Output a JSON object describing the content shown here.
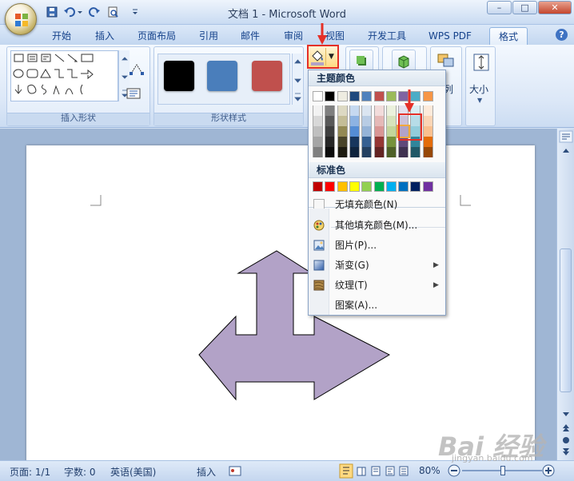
{
  "window": {
    "title": "文档 1 - Microsoft Word",
    "controls": {
      "minimize": "–",
      "maximize": "□",
      "close": "✕"
    }
  },
  "quick_access": [
    "save-icon",
    "undo-icon",
    "dropdown-icon",
    "redo-icon",
    "print-preview-icon",
    "customize-icon"
  ],
  "tabs": [
    {
      "label": "开始"
    },
    {
      "label": "插入"
    },
    {
      "label": "页面布局"
    },
    {
      "label": "引用"
    },
    {
      "label": "邮件"
    },
    {
      "label": "审阅"
    },
    {
      "label": "视图"
    },
    {
      "label": "开发工具"
    },
    {
      "label": "WPS PDF"
    },
    {
      "label": "格式",
      "active": true
    }
  ],
  "ribbon": {
    "groups": {
      "insert_shapes": "插入形状",
      "shape_styles": "形状样式",
      "size": "大小",
      "arrange_partial": "列"
    },
    "style_swatches": [
      "#000000",
      "#4a7ebb",
      "#c0504d"
    ]
  },
  "fill_menu": {
    "theme_colors_header": "主题颜色",
    "standard_colors_header": "标准色",
    "theme_top_row": [
      "#ffffff",
      "#000000",
      "#eeece1",
      "#1f497d",
      "#4f81bd",
      "#c0504d",
      "#9bbb59",
      "#8064a2",
      "#4bacc6",
      "#f79646"
    ],
    "theme_shades": [
      [
        "#f2f2f2",
        "#7f7f7f",
        "#ddd9c3",
        "#c6d9f0",
        "#dbe5f1",
        "#f2dcdb",
        "#ebf1dd",
        "#e5e0ec",
        "#dbeef3",
        "#fdeada"
      ],
      [
        "#d8d8d8",
        "#595959",
        "#c4bd97",
        "#8db3e2",
        "#b8cce4",
        "#e5b9b7",
        "#d7e3bc",
        "#ccc1d9",
        "#b7dde8",
        "#fbd5b5"
      ],
      [
        "#bfbfbf",
        "#3f3f3f",
        "#938953",
        "#548dd4",
        "#95b3d7",
        "#d99694",
        "#c3d69b",
        "#b2a2c7",
        "#92cddc",
        "#fac08f"
      ],
      [
        "#a5a5a5",
        "#262626",
        "#494429",
        "#17365d",
        "#366092",
        "#953734",
        "#76923c",
        "#5f497a",
        "#31859b",
        "#e36c09"
      ],
      [
        "#7f7f7f",
        "#0c0c0c",
        "#1d1b10",
        "#0f243e",
        "#244061",
        "#632423",
        "#4f6128",
        "#3f3151",
        "#205867",
        "#974806"
      ]
    ],
    "standard_colors": [
      "#c00000",
      "#ff0000",
      "#ffc000",
      "#ffff00",
      "#92d050",
      "#00b050",
      "#00b0f0",
      "#0070c0",
      "#002060",
      "#7030a0"
    ],
    "items": {
      "no_fill": "无填充颜色(N)",
      "more_colors": "其他填充颜色(M)...",
      "picture": "图片(P)...",
      "gradient": "渐变(G)",
      "texture": "纹理(T)",
      "pattern": "图案(A)..."
    },
    "selected_color": "#b2a2c7"
  },
  "shape": {
    "fill": "#b2a2c7",
    "stroke": "#000000"
  },
  "status": {
    "page": "页面: 1/1",
    "words": "字数: 0",
    "language": "英语(美国)",
    "mode": "插入",
    "zoom": "80%"
  },
  "watermark": {
    "text": "Bai 经验",
    "url": "jingyan.baidu.com"
  }
}
